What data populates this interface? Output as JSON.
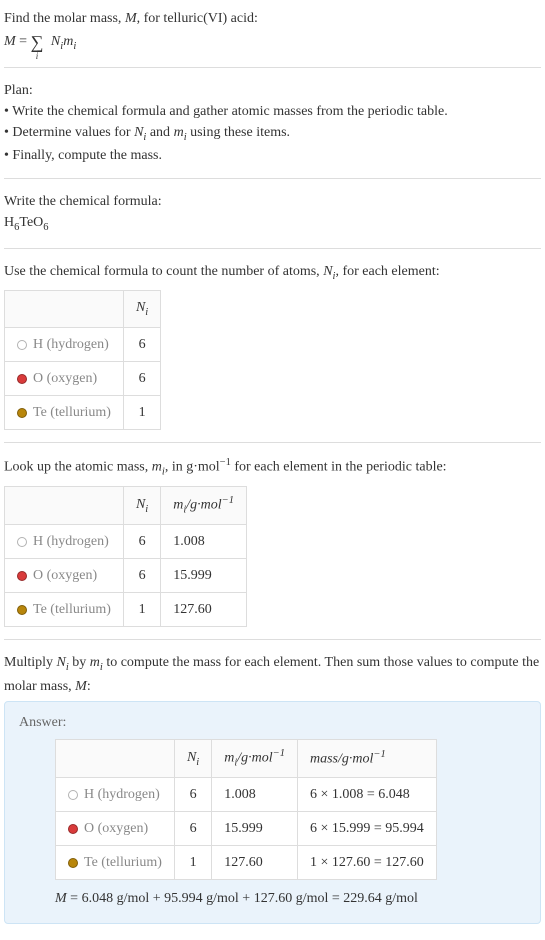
{
  "intro": {
    "line1_pre": "Find the molar mass, ",
    "line1_var": "M",
    "line1_post": ", for telluric(VI) acid:",
    "eq_left": "M",
    "eq_equals": " = ",
    "eq_sum": "∑",
    "eq_sum_idx": "i",
    "eq_terms_a": "N",
    "eq_terms_a_sub": "i",
    "eq_terms_b": "m",
    "eq_terms_b_sub": "i"
  },
  "plan": {
    "title": "Plan:",
    "b1_pre": "• Write the chemical formula and gather atomic masses from the periodic table.",
    "b2_pre": "• Determine values for ",
    "b2_n": "N",
    "b2_ni": "i",
    "b2_mid": " and ",
    "b2_m": "m",
    "b2_mi": "i",
    "b2_post": " using these items.",
    "b3": "• Finally, compute the mass."
  },
  "chemformula": {
    "title": "Write the chemical formula:",
    "h": "H",
    "h_n": "6",
    "te": "Te",
    "o": "O",
    "o_n": "6"
  },
  "count": {
    "intro_pre": "Use the chemical formula to count the number of atoms, ",
    "intro_n": "N",
    "intro_ni": "i",
    "intro_post": ", for each element:",
    "header_n": "N",
    "header_ni": "i",
    "rows": [
      {
        "el": "H (hydrogen)",
        "dotClass": "dot-h",
        "n": "6"
      },
      {
        "el": "O (oxygen)",
        "dotClass": "dot-o",
        "n": "6"
      },
      {
        "el": "Te (tellurium)",
        "dotClass": "dot-te",
        "n": "1"
      }
    ]
  },
  "lookup": {
    "intro_pre": "Look up the atomic mass, ",
    "intro_m": "m",
    "intro_mi": "i",
    "intro_mid": ", in g·mol",
    "intro_exp": "−1",
    "intro_post": " for each element in the periodic table:",
    "header_n": "N",
    "header_ni": "i",
    "header_m": "m",
    "header_mi": "i",
    "header_unit_pre": "/g·mol",
    "header_unit_exp": "−1",
    "rows": [
      {
        "el": "H (hydrogen)",
        "dotClass": "dot-h",
        "n": "6",
        "m": "1.008"
      },
      {
        "el": "O (oxygen)",
        "dotClass": "dot-o",
        "n": "6",
        "m": "15.999"
      },
      {
        "el": "Te (tellurium)",
        "dotClass": "dot-te",
        "n": "1",
        "m": "127.60"
      }
    ]
  },
  "compute": {
    "intro_pre": "Multiply ",
    "intro_n": "N",
    "intro_ni": "i",
    "intro_mid1": " by ",
    "intro_m": "m",
    "intro_mi": "i",
    "intro_post": " to compute the mass for each element. Then sum those values to compute the molar mass, ",
    "intro_M": "M",
    "intro_colon": ":"
  },
  "answer": {
    "label": "Answer:",
    "header_n": "N",
    "header_ni": "i",
    "header_m": "m",
    "header_mi": "i",
    "header_munit_pre": "/g·mol",
    "header_munit_exp": "−1",
    "header_mass_pre": "mass/g·mol",
    "header_mass_exp": "−1",
    "rows": [
      {
        "el": "H (hydrogen)",
        "dotClass": "dot-h",
        "n": "6",
        "m": "1.008",
        "mass": "6 × 1.008 = 6.048"
      },
      {
        "el": "O (oxygen)",
        "dotClass": "dot-o",
        "n": "6",
        "m": "15.999",
        "mass": "6 × 15.999 = 95.994"
      },
      {
        "el": "Te (tellurium)",
        "dotClass": "dot-te",
        "n": "1",
        "m": "127.60",
        "mass": "1 × 127.60 = 127.60"
      }
    ],
    "final_M": "M",
    "final_eq": " = 6.048 g/mol + 95.994 g/mol + 127.60 g/mol = 229.64 g/mol"
  }
}
